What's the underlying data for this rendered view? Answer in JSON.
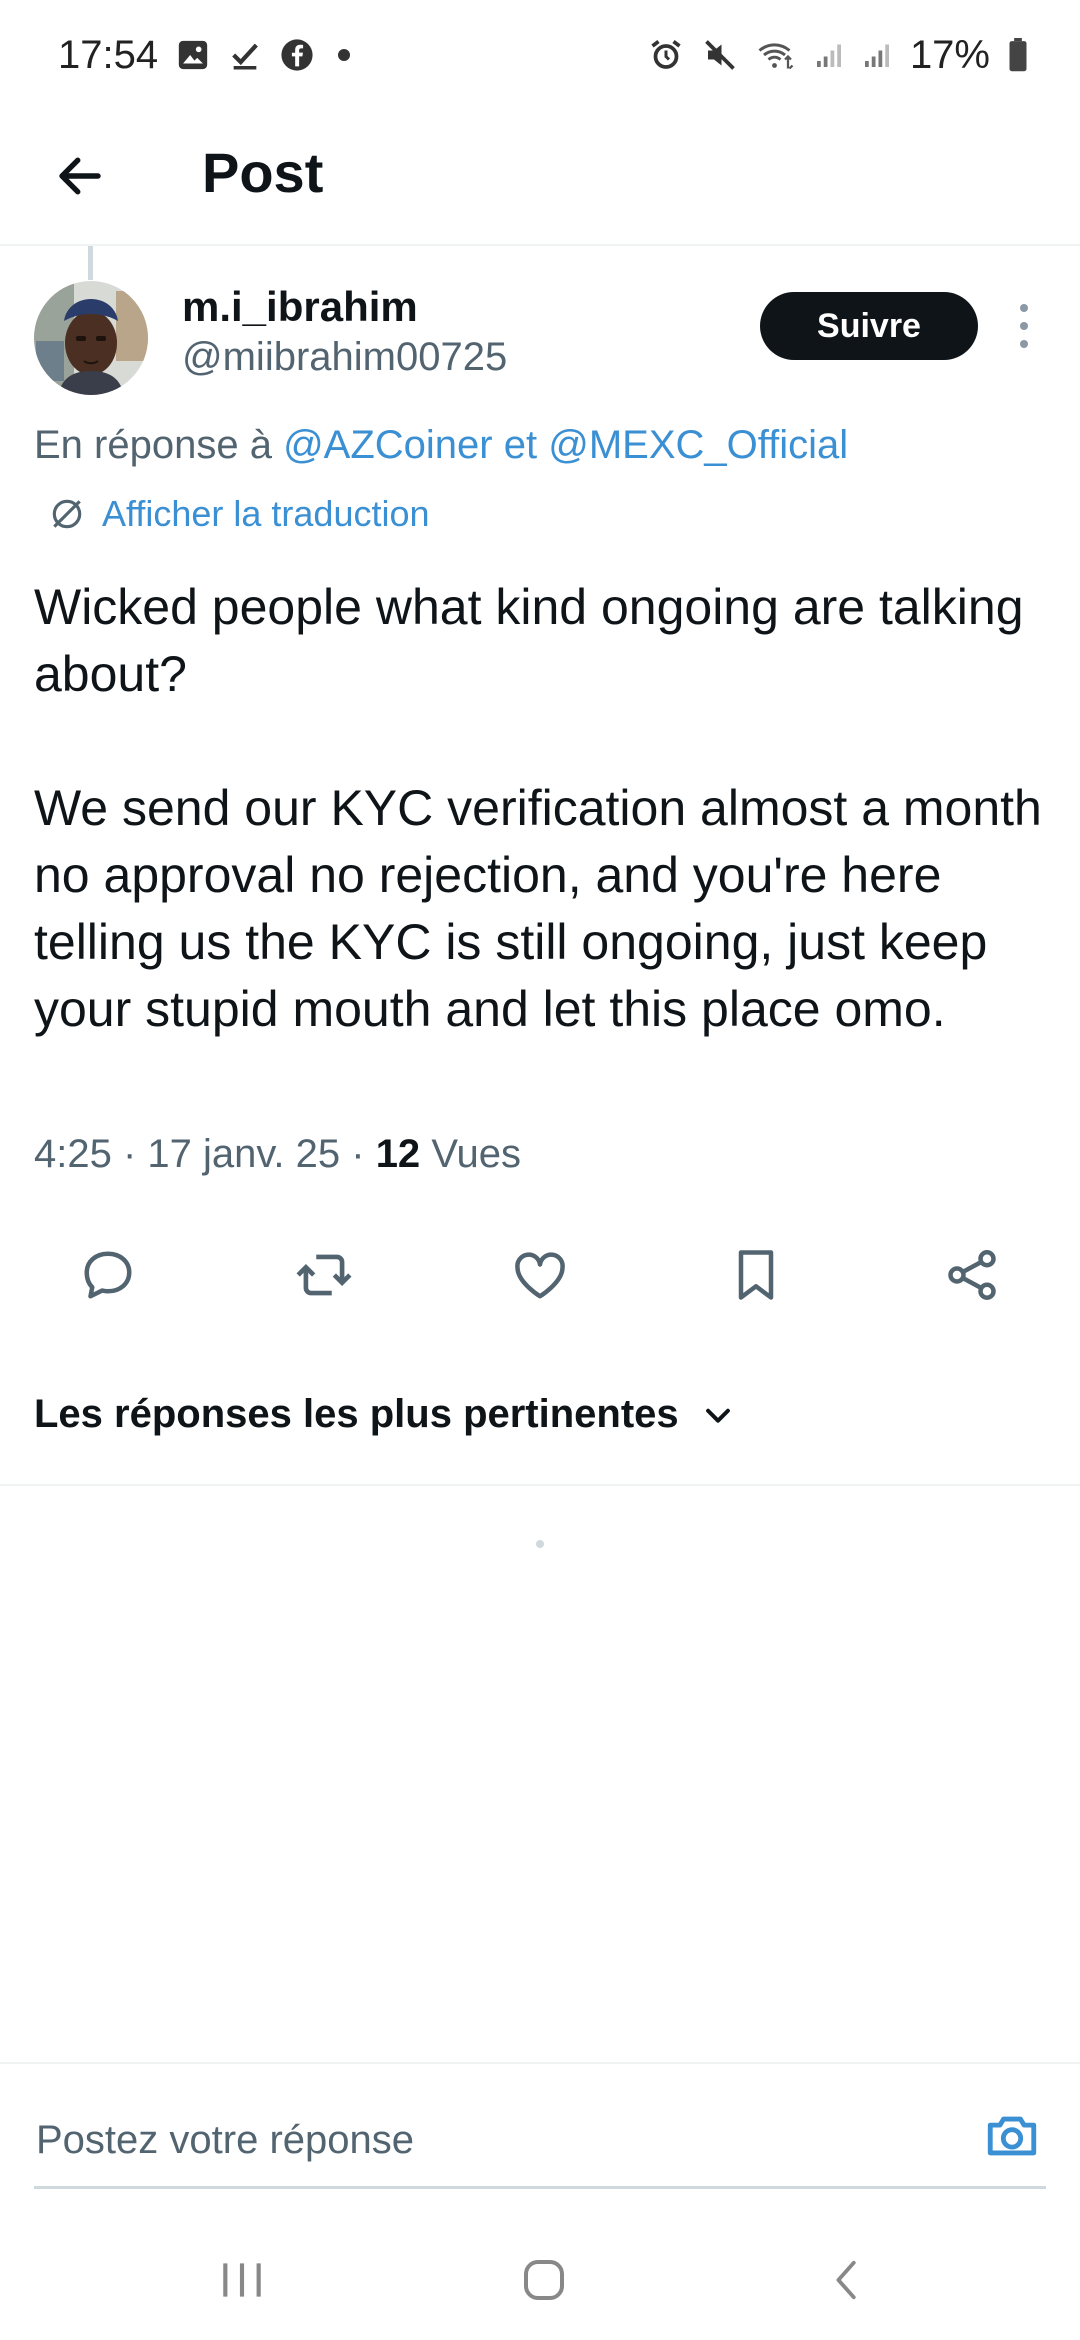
{
  "status_bar": {
    "time": "17:54",
    "battery": "17%",
    "left_icons": [
      "gallery-icon",
      "check-icon",
      "facebook-icon",
      "dot-icon"
    ],
    "right_icons": [
      "alarm-icon",
      "mute-icon",
      "wifi-icon",
      "signal-icon",
      "signal-icon",
      "battery-icon"
    ]
  },
  "header": {
    "title": "Post"
  },
  "post": {
    "author_name": "m.i_ibrahim",
    "author_handle": "@miibrahim00725",
    "follow_label": "Suivre",
    "reply_prefix": "En réponse à ",
    "reply_mention_1": "@AZCoiner",
    "reply_joiner": " et ",
    "reply_mention_2": "@MEXC_Official",
    "translate_label": "Afficher la traduction",
    "body": "Wicked people what kind ongoing are talking about?\n\nWe send our KYC verification almost a month no approval no rejection, and you're here telling us the KYC is still ongoing, just keep your stupid mouth and let this place omo.",
    "time": "4:25",
    "date": "17 janv. 25",
    "views_count": "12",
    "views_label": "Vues"
  },
  "actions": [
    {
      "name": "reply-icon"
    },
    {
      "name": "repost-icon"
    },
    {
      "name": "like-icon"
    },
    {
      "name": "bookmark-icon"
    },
    {
      "name": "share-icon"
    }
  ],
  "replies": {
    "sort_label": "Les réponses les plus pertinentes"
  },
  "composer": {
    "placeholder": "Postez votre réponse"
  },
  "colors": {
    "text": "#0f1419",
    "secondary": "#536471",
    "link": "#3b8fd3",
    "follow_bg": "#0f1419"
  }
}
